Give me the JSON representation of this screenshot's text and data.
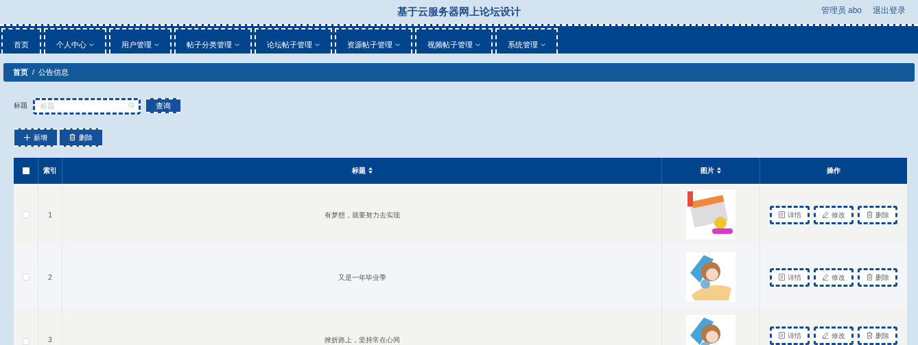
{
  "header": {
    "title": "基于云服务器网上论坛设计",
    "user": "管理员 abo",
    "logout": "退出登录"
  },
  "nav": [
    {
      "label": "首页",
      "dropdown": false
    },
    {
      "label": "个人中心",
      "dropdown": true
    },
    {
      "label": "用户管理",
      "dropdown": true
    },
    {
      "label": "帖子分类管理",
      "dropdown": true
    },
    {
      "label": "论坛帖子管理",
      "dropdown": true
    },
    {
      "label": "资源帖子管理",
      "dropdown": true
    },
    {
      "label": "视频帖子管理",
      "dropdown": true
    },
    {
      "label": "系统管理",
      "dropdown": true
    }
  ],
  "breadcrumb": {
    "items": [
      "首页",
      "公告信息"
    ],
    "separator": "/"
  },
  "search": {
    "label": "标题",
    "placeholder": "标题",
    "button": "查询"
  },
  "actions": [
    {
      "kind": "add",
      "label": "新增"
    },
    {
      "kind": "delete",
      "label": "删除"
    }
  ],
  "table": {
    "select_all": {
      "checked": false
    },
    "columns": [
      {
        "label": "索引",
        "sortable": false
      },
      {
        "label": "标题",
        "sortable": true
      },
      {
        "label": "图片",
        "sortable": true
      },
      {
        "label": "操作",
        "sortable": false
      }
    ],
    "rows": [
      {
        "checked": false,
        "index": "1",
        "title": "有梦想，就要努力去实现",
        "kind": "newspaper",
        "buttons": [
          {
            "kind": "detail",
            "label": "详情"
          },
          {
            "kind": "edit",
            "label": "修改"
          },
          {
            "kind": "delete",
            "label": "删除"
          }
        ]
      },
      {
        "checked": false,
        "index": "2",
        "title": "又是一年毕业季",
        "kind": "girl",
        "buttons": [
          {
            "kind": "detail",
            "label": "详情"
          },
          {
            "kind": "edit",
            "label": "修改"
          },
          {
            "kind": "delete",
            "label": "删除"
          }
        ]
      },
      {
        "checked": false,
        "index": "3",
        "title": "挫折路上，坚持常在心间",
        "kind": "girl",
        "buttons": [
          {
            "kind": "detail",
            "label": "详情"
          },
          {
            "kind": "edit",
            "label": "修改"
          },
          {
            "kind": "delete",
            "label": "删除"
          }
        ]
      }
    ]
  }
}
